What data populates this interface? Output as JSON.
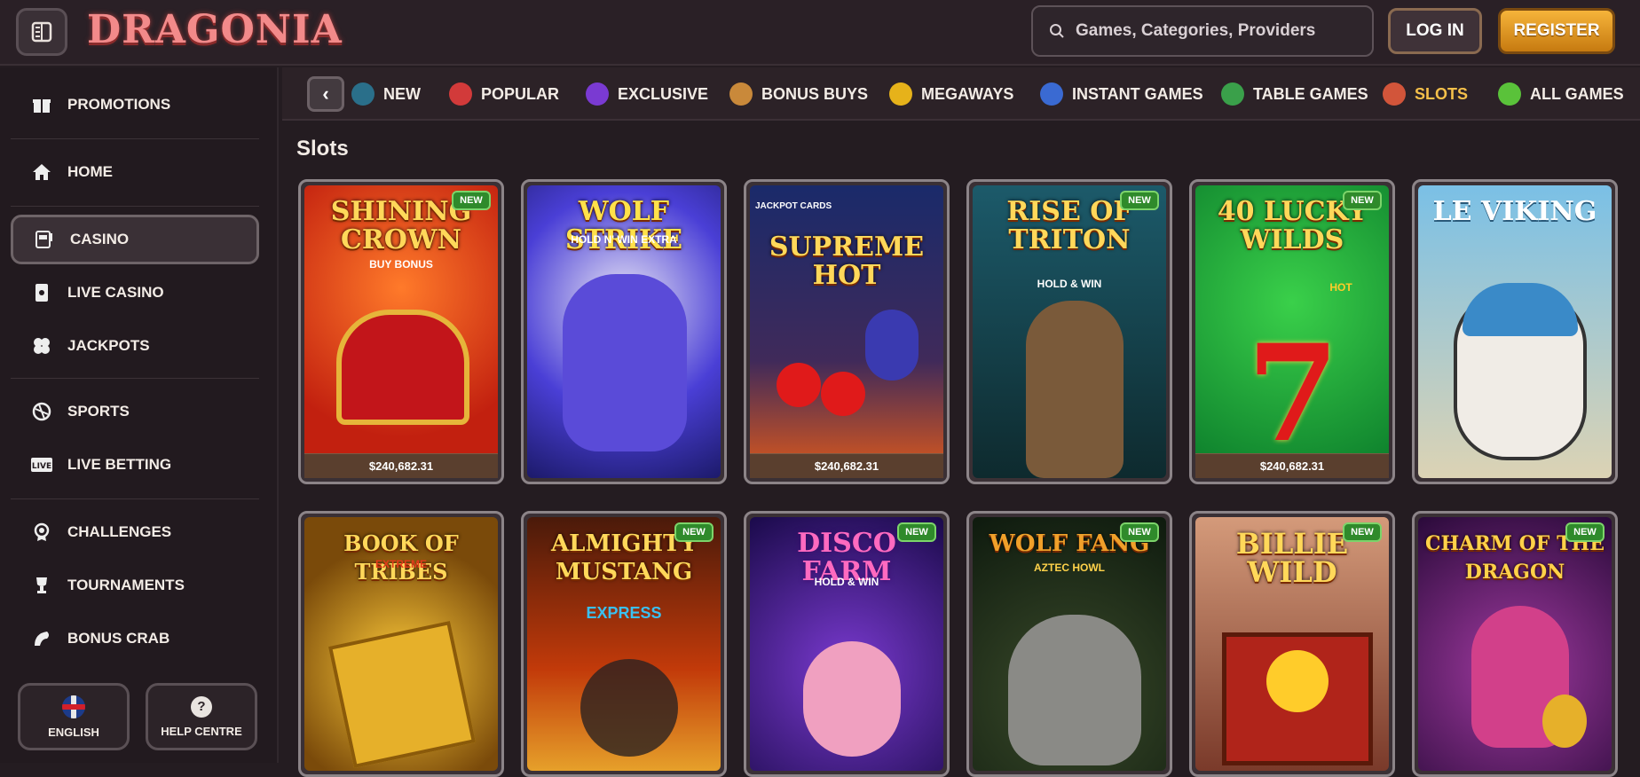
{
  "header": {
    "logo": "DRAGONIA",
    "search_placeholder": "Games, Categories, Providers",
    "login_label": "LOG IN",
    "register_label": "REGISTER"
  },
  "sidebar": {
    "items": [
      {
        "label": "PROMOTIONS",
        "icon": "gift-icon"
      },
      {
        "label": "HOME",
        "icon": "home-icon"
      },
      {
        "label": "CASINO",
        "icon": "slot-machine-icon",
        "active": true
      },
      {
        "label": "LIVE CASINO",
        "icon": "card-icon"
      },
      {
        "label": "JACKPOTS",
        "icon": "clover-icon"
      },
      {
        "label": "SPORTS",
        "icon": "ball-icon"
      },
      {
        "label": "LIVE BETTING",
        "icon": "live-icon"
      },
      {
        "label": "CHALLENGES",
        "icon": "medal-icon"
      },
      {
        "label": "TOURNAMENTS",
        "icon": "trophy-icon"
      },
      {
        "label": "BONUS CRAB",
        "icon": "crab-icon"
      }
    ],
    "language_label": "ENGLISH",
    "help_label": "HELP CENTRE"
  },
  "categories": [
    {
      "label": "NEW",
      "color": "#2a6f8a"
    },
    {
      "label": "POPULAR",
      "color": "#d23a3a"
    },
    {
      "label": "EXCLUSIVE",
      "color": "#7a3ad2"
    },
    {
      "label": "BONUS BUYS",
      "color": "#c9893a"
    },
    {
      "label": "MEGAWAYS",
      "color": "#e6b21a"
    },
    {
      "label": "INSTANT GAMES",
      "color": "#3a6ad2"
    },
    {
      "label": "TABLE GAMES",
      "color": "#3aa04a"
    },
    {
      "label": "SLOTS",
      "color": "#d2553a",
      "active": true
    },
    {
      "label": "ALL GAMES",
      "color": "#5ac23a"
    }
  ],
  "section_title": "Slots",
  "games_row1": [
    {
      "title": "SHINING CROWN",
      "sub": "BUY BONUS",
      "badge": "NEW",
      "jackpot": "$240,682.31"
    },
    {
      "title": "WOLF STRIKE",
      "sub": "HOLD N' WIN EXTRA",
      "badge": "",
      "jackpot": ""
    },
    {
      "title": "SUPREME HOT",
      "sub": "JACKPOT CARDS",
      "badge": "",
      "jackpot": "$240,682.31"
    },
    {
      "title": "RISE OF TRITON",
      "sub": "HOLD & WIN",
      "badge": "NEW",
      "jackpot": ""
    },
    {
      "title": "40 LUCKY WILDS",
      "sub": "HOT",
      "badge": "NEW",
      "jackpot": "$240,682.31"
    },
    {
      "title": "LE VIKING",
      "sub": "",
      "badge": "",
      "jackpot": ""
    }
  ],
  "games_row2": [
    {
      "title": "BOOK OF TRIBES",
      "sub": "EXTREME",
      "badge": ""
    },
    {
      "title": "ALMIGHTY MUSTANG",
      "sub": "EXPRESS",
      "badge": "NEW"
    },
    {
      "title": "DISCO FARM",
      "sub": "HOLD & WIN",
      "badge": "NEW"
    },
    {
      "title": "WOLF FANG",
      "sub": "AZTEC HOWL",
      "badge": "NEW"
    },
    {
      "title": "BILLIE WILD",
      "sub": "",
      "badge": "NEW"
    },
    {
      "title": "CHARM OF THE DRAGON",
      "sub": "",
      "badge": "NEW"
    }
  ]
}
